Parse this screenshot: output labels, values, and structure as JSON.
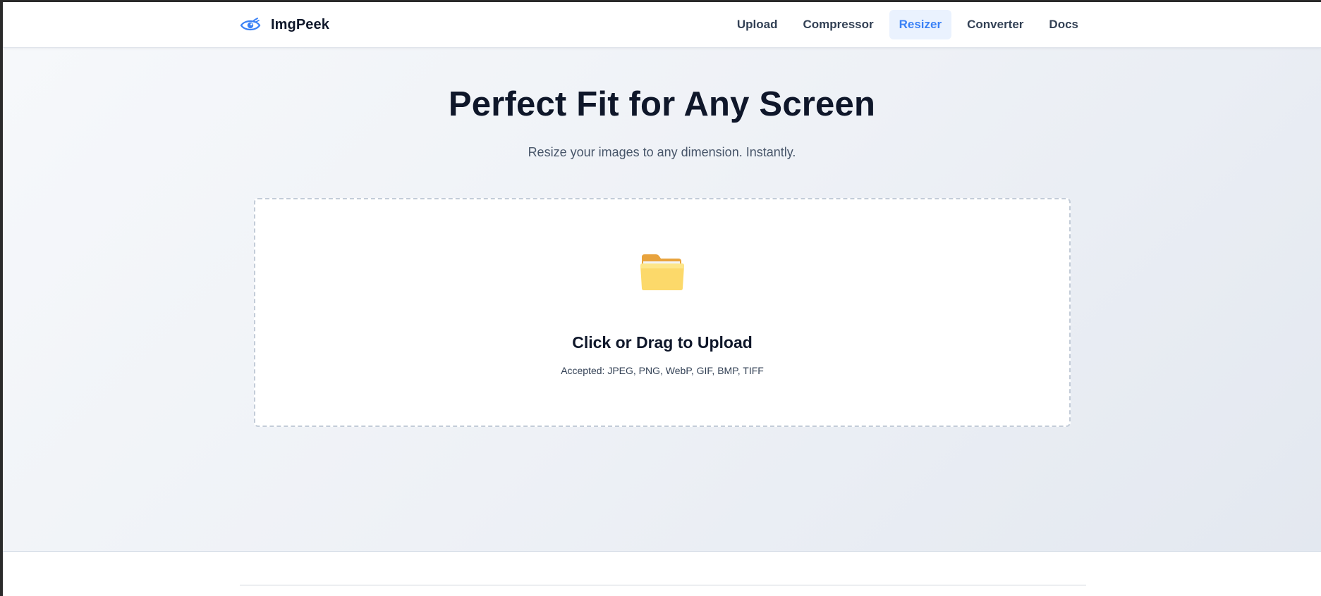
{
  "brand": {
    "name": "ImgPeek",
    "icon": "eye-logo-icon",
    "accent": "#3b82f6"
  },
  "nav": {
    "items": [
      {
        "label": "Upload",
        "active": false
      },
      {
        "label": "Compressor",
        "active": false
      },
      {
        "label": "Resizer",
        "active": true
      },
      {
        "label": "Converter",
        "active": false
      },
      {
        "label": "Docs",
        "active": false
      }
    ]
  },
  "hero": {
    "title": "Perfect Fit for Any Screen",
    "subtitle": "Resize your images to any dimension. Instantly."
  },
  "dropzone": {
    "icon": "folder-icon",
    "title": "Click or Drag to Upload",
    "accepted": "Accepted: JPEG, PNG, WebP, GIF, BMP, TIFF"
  },
  "colors": {
    "text_dark": "#0f172a",
    "text_muted": "#475569",
    "nav_active_bg": "#eaf2fe",
    "nav_active_text": "#3b82f6",
    "dropzone_border": "#c3ccd8"
  }
}
